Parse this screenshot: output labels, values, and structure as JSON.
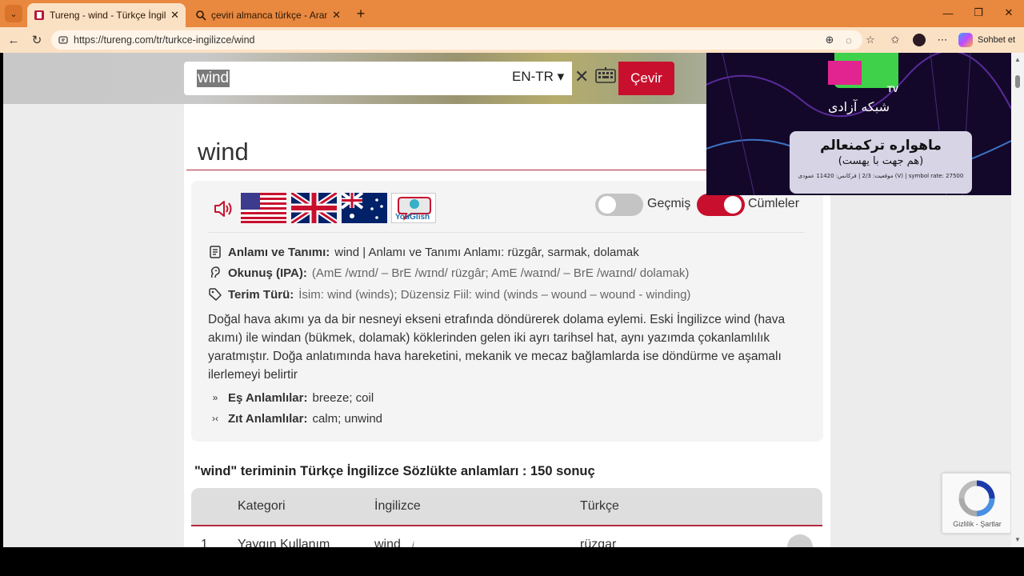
{
  "browser": {
    "tabs": [
      {
        "label": "Tureng - wind - Türkçe İngilizce Sö",
        "active": true
      },
      {
        "label": "çeviri almanca türkçe - Arama",
        "active": false
      }
    ],
    "url": "https://tureng.com/tr/turkce-ingilizce/wind",
    "copilot_label": "Sohbet et"
  },
  "search": {
    "query": "wind",
    "language": "EN-TR ▾",
    "submit_label": "Çevir"
  },
  "entry": {
    "title": "wind",
    "toggles": {
      "history_label": "Geçmiş",
      "history_on": false,
      "sentences_label": "Cümleler",
      "sentences_on": true
    },
    "youglish_label": "YouGlish",
    "meaning_label": "Anlamı ve Tanımı:",
    "meaning_value": "wind | Anlamı ve Tanımı Anlamı: rüzgâr, sarmak, dolamak",
    "ipa_label": "Okunuş (IPA):",
    "ipa_value": "(AmE /wɪnd/ – BrE /wɪnd/ rüzgâr; AmE /waɪnd/ – BrE /waɪnd/ dolamak)",
    "term_label": "Terim Türü:",
    "term_value": "İsim: wind (winds); Düzensiz Fiil: wind (winds – wound – wound - winding)",
    "description": "Doğal hava akımı ya da bir nesneyi ekseni etrafında döndürerek dolama eylemi. Eski İngilizce wind (hava akımı) ile windan (bükmek, dolamak) köklerinden gelen iki ayrı tarihsel hat, aynı yazımda çokanlamlılık yaratmıştır. Doğa anlatımında hava hareketini, mekanik ve mecaz bağlamlarda ise döndürme ve aşamalı ilerlemeyi belirtir",
    "synonyms_label": "Eş Anlamlılar:",
    "synonyms_value": "breeze; coil",
    "antonyms_label": "Zıt Anlamlılar:",
    "antonyms_value": "calm; unwind"
  },
  "results": {
    "title": "\"wind\" teriminin Türkçe İngilizce Sözlükte anlamları : 150 sonuç",
    "columns": [
      "Kategori",
      "İngilizce",
      "Türkçe"
    ],
    "rows": [
      {
        "index": "1",
        "category": "Yaygın Kullanım",
        "english": "wind",
        "type": "i.",
        "turkish": "rüzgar"
      }
    ]
  },
  "video_overlay": {
    "channel": "TV",
    "line1": "شبکه آزادی",
    "line2": "ماهواره ترکمنعالم",
    "line3": "(هم جهت با یهست)",
    "line4": "موقعیت: 2/3 | فرکانس: 11420 عمودی (V) | symbol rate: 27500"
  },
  "recaptcha": {
    "label": "Gizlilik - Şartlar"
  },
  "colors": {
    "accent": "#c8102e",
    "chrome": "#e9883f",
    "toolbar": "#fbe1c4"
  }
}
